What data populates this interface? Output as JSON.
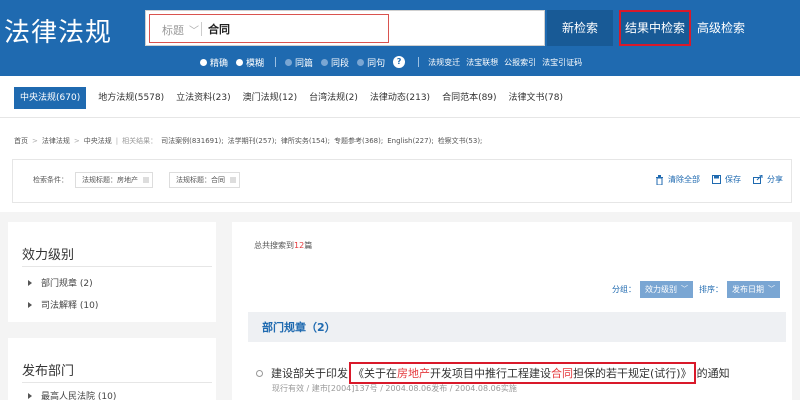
{
  "header": {
    "logo": "法律法规",
    "search": {
      "field_label": "标题",
      "query": "合同"
    },
    "new_search": "新检索",
    "result_search": "结果中检索",
    "advanced_search": "高级检索",
    "options": {
      "match": [
        {
          "label": "精确",
          "selected": true
        },
        {
          "label": "模糊",
          "selected": false
        }
      ],
      "scope": [
        {
          "label": "同篇",
          "selected": false
        },
        {
          "label": "同段",
          "selected": false
        },
        {
          "label": "同句",
          "selected": false
        }
      ],
      "help": "?",
      "links": [
        "法规变迁",
        "法宝联想",
        "公报索引",
        "法宝引证码"
      ]
    }
  },
  "tabs": [
    {
      "label": "中央法规(670)",
      "active": true
    },
    {
      "label": "地方法规(5578)"
    },
    {
      "label": "立法资料(23)"
    },
    {
      "label": "澳门法规(12)"
    },
    {
      "label": "台湾法规(2)"
    },
    {
      "label": "法律动态(213)"
    },
    {
      "label": "合同范本(89)"
    },
    {
      "label": "法律文书(78)"
    }
  ],
  "breadcrumb": {
    "path": [
      "首页",
      "法律法规",
      "中央法规"
    ],
    "related_label": "相关结果：",
    "related": [
      "司法案例(831691);",
      "法学期刊(257);",
      "律所实务(154);",
      "专题参考(368);",
      "English(227);",
      "检察文书(53);"
    ]
  },
  "conditions": {
    "label": "检索条件：",
    "chips": [
      "法规标题：房地产",
      "法规标题：合同"
    ],
    "actions": {
      "clear": "清除全部",
      "save": "保存",
      "share": "分享"
    }
  },
  "sidebar": {
    "level": {
      "title": "效力级别",
      "items": [
        "部门规章 (2)",
        "司法解释 (10)"
      ]
    },
    "dept": {
      "title": "发布部门",
      "items": [
        "最高人民法院 (10)"
      ]
    }
  },
  "main": {
    "total_prefix": "总共搜索到",
    "total_count": "12",
    "total_suffix": "篇",
    "group_label": "分组：",
    "group_value": "效力级别",
    "sort_label": "排序：",
    "sort_value": "发布日期",
    "group_title": "部门规章（2）",
    "result": {
      "prefix": "建设部关于印发",
      "t1": "《关于在",
      "kw1": "房地产",
      "t2": "开发项目中推行工程建设",
      "kw2": "合同",
      "t3": "担保的若干规定(试行)》",
      "suffix": "的通知",
      "meta": "现行有效 / 建市[2004]137号 / 2004.08.06发布 / 2004.08.06实施"
    }
  },
  "colors": {
    "header": "#1f6ab0",
    "highlight": "#e4393c",
    "frame": "#d9192a"
  }
}
